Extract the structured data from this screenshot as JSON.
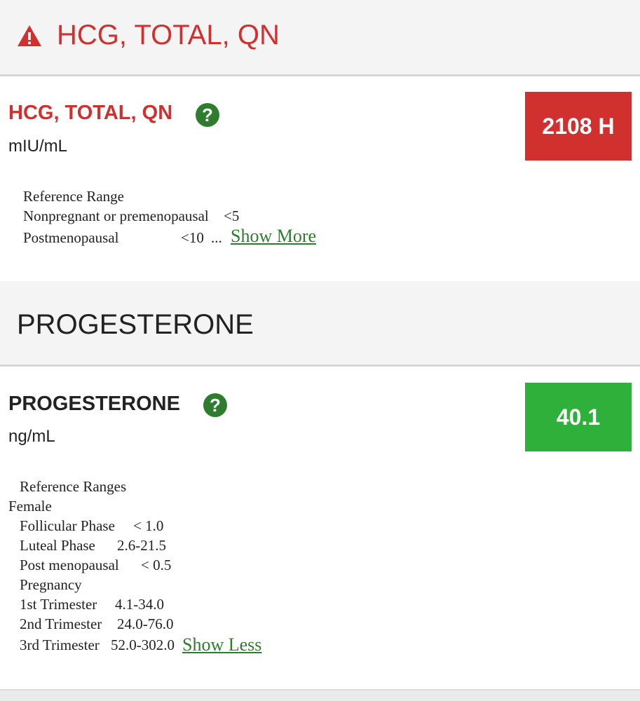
{
  "section1": {
    "header": "HCG, TOTAL, QN",
    "test_name": "HCG, TOTAL, QN",
    "unit": "mIU/mL",
    "value": "2108 H",
    "value_color": "#d0312f",
    "title_color": "#d0312f",
    "ref_title": "Reference Range",
    "ref_lines": [
      {
        "label": "Nonpregnant or premenopausal",
        "value": "<5"
      },
      {
        "label": "Postmenopausal",
        "value": "<10"
      }
    ],
    "ellipsis": "...",
    "show_more": "Show More"
  },
  "section2": {
    "header": "PROGESTERONE",
    "test_name": "PROGESTERONE",
    "unit": "ng/mL",
    "value": "40.1",
    "value_color": "#2fb03a",
    "ref_title": "Reference Ranges",
    "ref_group_female": "Female",
    "ref_lines": [
      {
        "label": "Follicular Phase",
        "value": "< 1.0"
      },
      {
        "label": "Luteal Phase",
        "value": "2.6-21.5"
      },
      {
        "label": "Post menopausal",
        "value": "< 0.5"
      }
    ],
    "ref_group_pregnancy": "Pregnancy",
    "trimesters": [
      {
        "label": "1st Trimester",
        "value": "4.1-34.0"
      },
      {
        "label": "2nd Trimester",
        "value": "24.0-76.0"
      },
      {
        "label": "3rd Trimester",
        "value": "52.0-302.0"
      }
    ],
    "show_less": "Show Less"
  },
  "icons": {
    "warning": "warning-triangle-icon",
    "help": "question-circle-icon"
  }
}
